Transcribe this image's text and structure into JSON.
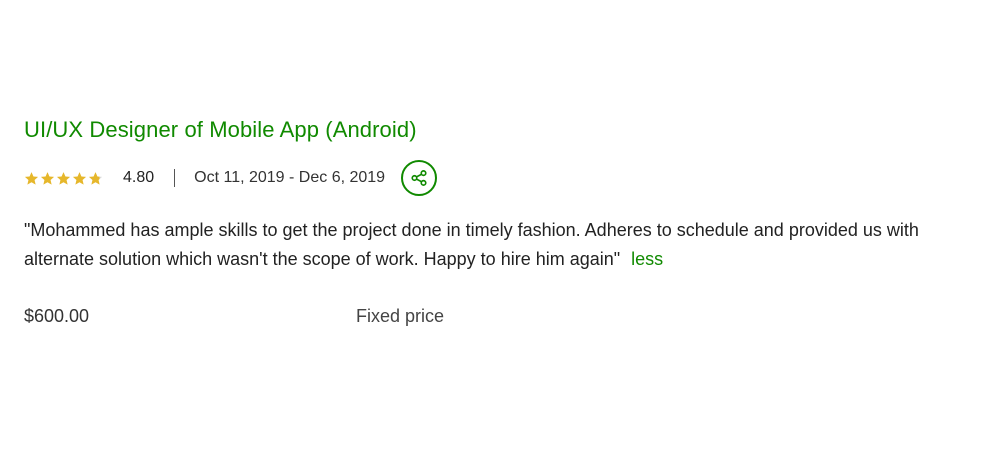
{
  "job": {
    "title": "UI/UX Designer of Mobile App (Android)",
    "rating": "4.80",
    "rating_stars": 4.8,
    "date_range": "Oct 11, 2019 - Dec 6, 2019",
    "feedback": "\"Mohammed has ample skills to get the project done in timely fashion. Adheres to schedule and provided us with alternate solution which wasn't the scope of work. Happy to hire him again\"",
    "less_label": "less",
    "price": "$600.00",
    "price_type": "Fixed price"
  },
  "icons": {
    "share": "share-icon",
    "star": "star-icon"
  },
  "colors": {
    "accent": "#108a00",
    "star": "#e6b72b"
  }
}
